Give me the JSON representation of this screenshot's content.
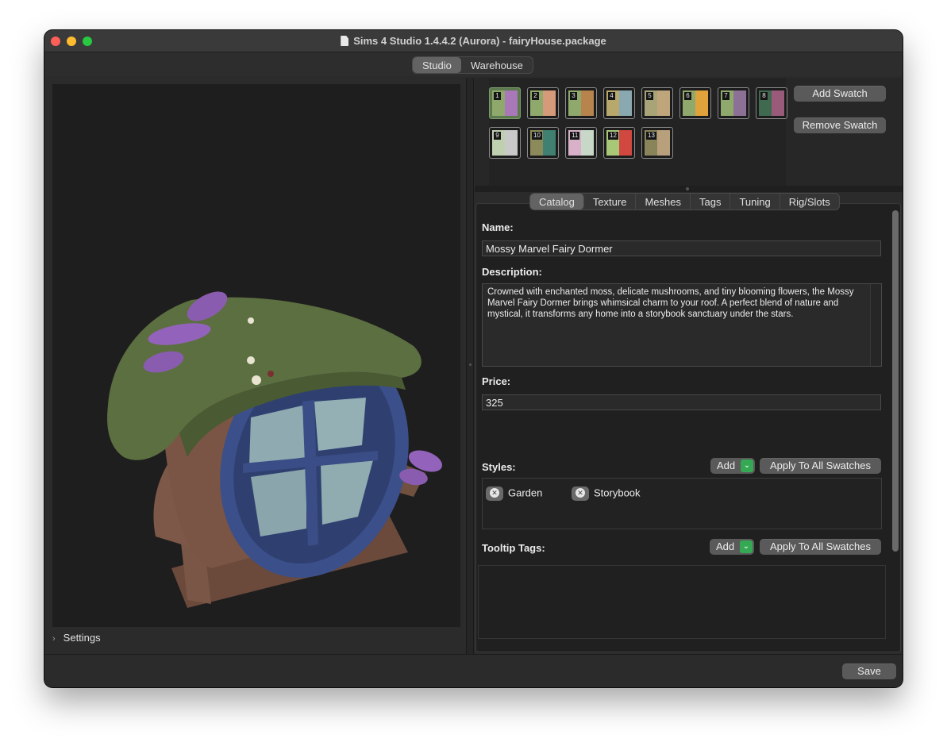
{
  "window": {
    "title": "Sims 4 Studio 1.4.4.2 (Aurora)  - fairyHouse.package"
  },
  "mode_tabs": [
    {
      "label": "Studio",
      "active": true
    },
    {
      "label": "Warehouse",
      "active": false
    }
  ],
  "viewport": {
    "settings_label": "Settings"
  },
  "swatches": [
    {
      "num": "1",
      "colors": [
        "#8fa86b",
        "#a878b8"
      ],
      "selected": true
    },
    {
      "num": "2",
      "colors": [
        "#8fa86b",
        "#d49a7a"
      ]
    },
    {
      "num": "3",
      "colors": [
        "#8fa86b",
        "#b8844e"
      ]
    },
    {
      "num": "4",
      "colors": [
        "#b9a86b",
        "#8aa8b0"
      ]
    },
    {
      "num": "5",
      "colors": [
        "#a9a478",
        "#bfa57c"
      ]
    },
    {
      "num": "6",
      "colors": [
        "#8fa86b",
        "#e0a23a"
      ]
    },
    {
      "num": "7",
      "colors": [
        "#8fa86b",
        "#8d7096"
      ]
    },
    {
      "num": "8",
      "colors": [
        "#3f6a50",
        "#9a5a7a"
      ]
    },
    {
      "num": "9",
      "colors": [
        "#bfd0b0",
        "#c9c9c9"
      ]
    },
    {
      "num": "10",
      "colors": [
        "#8a8a5a",
        "#3f8070"
      ]
    },
    {
      "num": "11",
      "colors": [
        "#d8b0c8",
        "#c8d8c8"
      ]
    },
    {
      "num": "12",
      "colors": [
        "#a8c878",
        "#d04840"
      ]
    },
    {
      "num": "13",
      "colors": [
        "#8a845a",
        "#b8a07c"
      ]
    }
  ],
  "swatch_actions": {
    "add": "Add Swatch",
    "remove": "Remove Swatch"
  },
  "tabs": [
    {
      "label": "Catalog",
      "active": true
    },
    {
      "label": "Texture"
    },
    {
      "label": "Meshes"
    },
    {
      "label": "Tags"
    },
    {
      "label": "Tuning"
    },
    {
      "label": "Rig/Slots"
    }
  ],
  "form": {
    "name_label": "Name:",
    "name_value": "Mossy Marvel Fairy Dormer",
    "description_label": "Description:",
    "description_value": "Crowned with enchanted moss, delicate mushrooms, and tiny blooming flowers, the Mossy Marvel Fairy Dormer brings whimsical charm to your roof. A perfect blend of nature and mystical, it transforms any home into a storybook sanctuary under the stars.",
    "price_label": "Price:",
    "price_value": "325",
    "styles_label": "Styles:",
    "styles_add": "Add",
    "styles_apply": "Apply To All Swatches",
    "styles": [
      "Garden",
      "Storybook"
    ],
    "tooltip_label": "Tooltip Tags:",
    "tooltip_add": "Add",
    "tooltip_apply": "Apply To All Swatches"
  },
  "footer": {
    "save": "Save"
  }
}
